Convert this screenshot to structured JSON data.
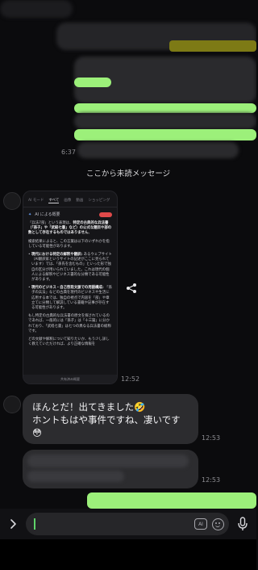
{
  "messages": {
    "prev_time": "6:37",
    "unread_divider": "ここから未読メッセージ",
    "screenshot": {
      "time": "12:52",
      "tabs": [
        "AI モード",
        "すべて",
        "画像",
        "動画",
        "ショッピング"
      ],
      "ai_header": "AI による概要",
      "para1_pre": "「兵法7部」という表現は、",
      "para1_bold": "特定の古典的な兵法書（「孫子」や「武経七書」など）の公式な題目や部の数として存在するものではありません",
      "para1_post": "。",
      "para2": "検索結果によると、この言葉は以下のいずれかを指している可能性があります。",
      "item1_bold": "現代における特定の解釈や翻訳:",
      "item1_pre": " あるウェブサイト（",
      "item1_link": "AI翻訳家というサイトの記述がここに見られています",
      "item1_post": "）では、「孫氏を含むもの」といった形で独自の区分が用いられていました。これは現代の個人による解釈やビジネス書的な分類である可能性があります。",
      "item2_bold": "現代のビジネス・自己啓発文脈での用語構成:",
      "item2_text": " 「孫子の兵法」などの古典を現代のビジネスや生活に応用する本では、独自の視点で内容を「部」や章立てに分類して解説している書籍や記事が存在する可能性があります。",
      "para3": "もし特定の古典的な兵法書の原文を探されているのであれば、一般的には「孫子」は「十三篇」に分かれており、「武経七書」は七つの異なる兵法書の総称です。",
      "para4": "どの文献や解釈について知りたいか、もう少し詳しく教えていただければ、より正確な情報を",
      "footer": "共有済み概要"
    },
    "reply": {
      "line1": "ほんとだ！出てきました🤣",
      "line2": "ホントもはや事件ですね、凄いです",
      "line3": "😳",
      "time": "12:53"
    },
    "next_time": "12:53"
  },
  "input": {
    "ai_label": "AI",
    "placeholder": ""
  }
}
